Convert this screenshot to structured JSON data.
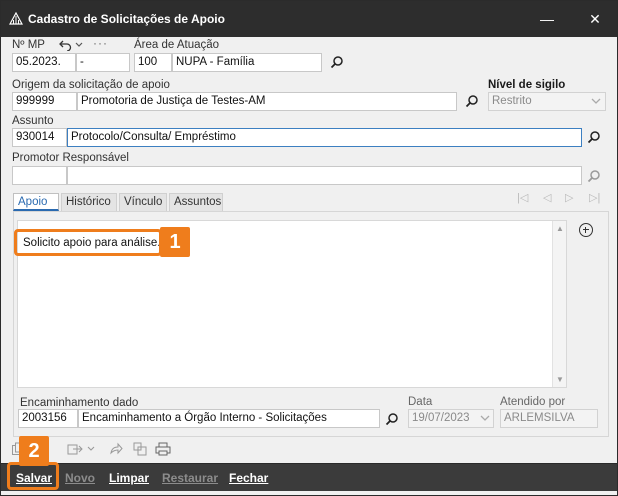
{
  "window": {
    "title": "Cadastro de Solicitações de Apoio",
    "controls": {
      "minimize": "—",
      "close": "✕"
    }
  },
  "fields": {
    "numero_mp": {
      "label": "Nº MP",
      "part1": "05.2023.",
      "part2": "-"
    },
    "area_atuacao": {
      "label": "Área de Atuação",
      "code": "100",
      "name": "NUPA - Família"
    },
    "origem": {
      "label": "Origem da solicitação de apoio",
      "code": "999999",
      "name": "Promotoria de Justiça de Testes-AM"
    },
    "nivel_sigilo": {
      "label": "Nível de sigilo",
      "value": "Restrito"
    },
    "assunto": {
      "label": "Assunto",
      "code": "930014",
      "name": "Protocolo/Consulta/ Empréstimo"
    },
    "promotor": {
      "label": "Promotor Responsável",
      "code": "",
      "name": ""
    }
  },
  "tabs": [
    {
      "label": "Apoio",
      "active": true
    },
    {
      "label": "Histórico",
      "active": false
    },
    {
      "label": "Vínculo",
      "active": false
    },
    {
      "label": "Assuntos",
      "active": false
    }
  ],
  "nav": {
    "first": "|◁",
    "prev": "◁",
    "next": "▷",
    "last": "▷|"
  },
  "apoio": {
    "text": "Solicito apoio para análise.",
    "encaminhamento": {
      "label": "Encaminhamento dado",
      "code": "2003156",
      "name": "Encaminhamento a Órgão Interno - Solicitações"
    },
    "data": {
      "label": "Data",
      "value": "19/07/2023"
    },
    "atendido_por": {
      "label": "Atendido por",
      "value": "ARLEMSILVA"
    }
  },
  "actions": [
    {
      "label": "Salvar",
      "enabled": true
    },
    {
      "label": "Novo",
      "enabled": false
    },
    {
      "label": "Limpar",
      "enabled": true
    },
    {
      "label": "Restaurar",
      "enabled": false
    },
    {
      "label": "Fechar",
      "enabled": true
    }
  ],
  "annotations": [
    {
      "number": "1"
    },
    {
      "number": "2"
    }
  ],
  "colors": {
    "accent": "#ef7d1c",
    "titlebar": "#2d2d2d",
    "actionbar": "#3b3b3b",
    "focus": "#3c7fc1",
    "tab_active": "#2a6ab0"
  }
}
